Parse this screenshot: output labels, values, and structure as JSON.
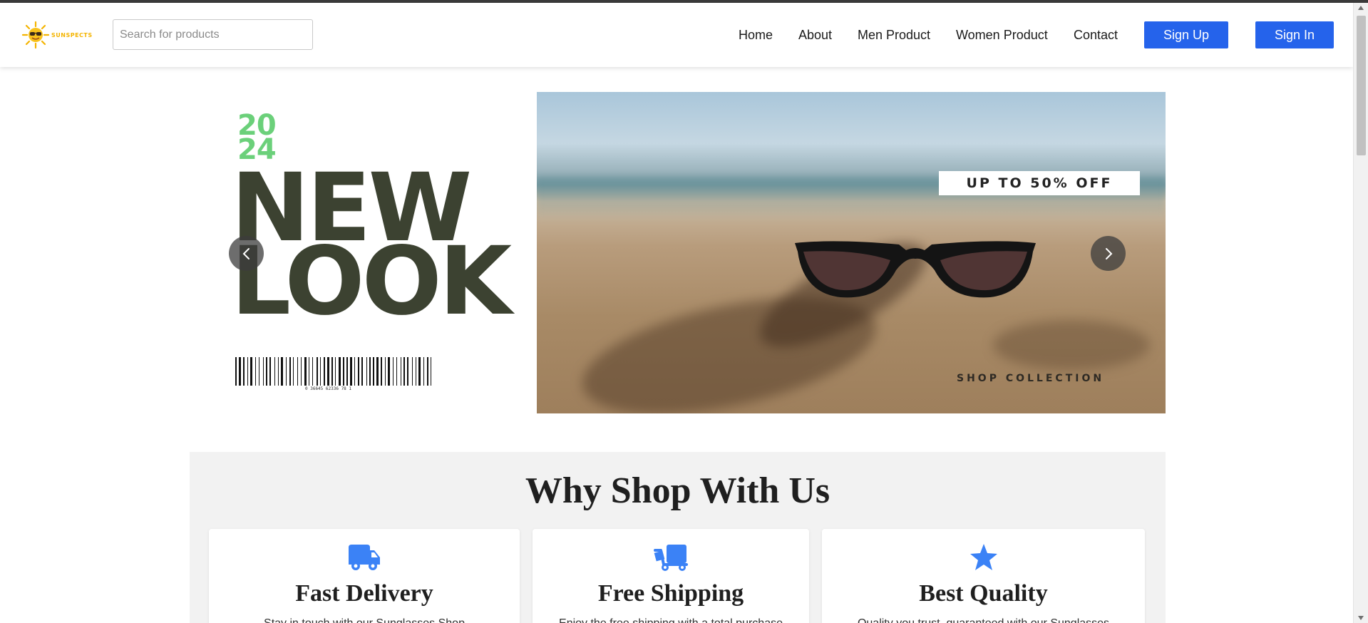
{
  "brand": {
    "name": "SUNSPECTS",
    "accent": "#f4b400"
  },
  "search": {
    "placeholder": "Search for products"
  },
  "nav": {
    "items": [
      "Home",
      "About",
      "Men Product",
      "Women Product",
      "Contact"
    ],
    "signup_label": "Sign Up",
    "signin_label": "Sign In",
    "button_color": "#2563eb"
  },
  "banner": {
    "year_top": "20",
    "year_bottom": "24",
    "headline_line1": "NEW",
    "headline_line2": "LOOK",
    "barcode_number": "0 36645 62336 78 1",
    "offer": "UP TO 50% OFF",
    "cta": "SHOP COLLECTION",
    "year_color": "#6bd07a",
    "headline_color": "#3c4231",
    "prev_icon": "chevron-left-icon",
    "next_icon": "chevron-right-icon"
  },
  "why": {
    "title": "Why Shop With Us",
    "features": [
      {
        "title": "Fast Delivery",
        "icon": "truck-icon",
        "text": "Stay in touch with our Sunglasses Shop"
      },
      {
        "title": "Free Shipping",
        "icon": "dolly-icon",
        "text": "Enjoy the free shipping with a total purchase"
      },
      {
        "title": "Best Quality",
        "icon": "star-icon",
        "text": "Quality you trust, guaranteed with our Sunglasses"
      }
    ],
    "icon_color": "#3b82f6"
  }
}
